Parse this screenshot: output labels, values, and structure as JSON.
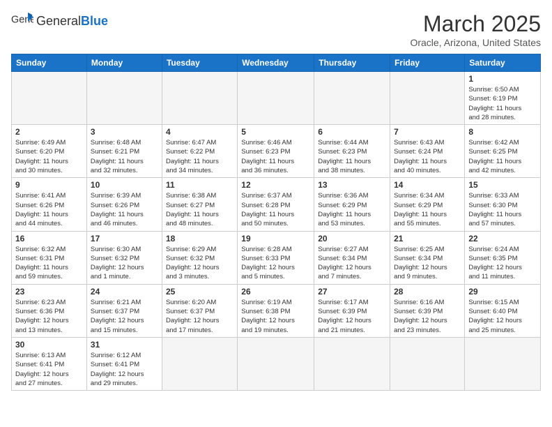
{
  "header": {
    "logo_general": "General",
    "logo_blue": "Blue",
    "month_title": "March 2025",
    "location": "Oracle, Arizona, United States"
  },
  "weekdays": [
    "Sunday",
    "Monday",
    "Tuesday",
    "Wednesday",
    "Thursday",
    "Friday",
    "Saturday"
  ],
  "weeks": [
    [
      {
        "day": "",
        "info": ""
      },
      {
        "day": "",
        "info": ""
      },
      {
        "day": "",
        "info": ""
      },
      {
        "day": "",
        "info": ""
      },
      {
        "day": "",
        "info": ""
      },
      {
        "day": "",
        "info": ""
      },
      {
        "day": "1",
        "info": "Sunrise: 6:50 AM\nSunset: 6:19 PM\nDaylight: 11 hours\nand 28 minutes."
      }
    ],
    [
      {
        "day": "2",
        "info": "Sunrise: 6:49 AM\nSunset: 6:20 PM\nDaylight: 11 hours\nand 30 minutes."
      },
      {
        "day": "3",
        "info": "Sunrise: 6:48 AM\nSunset: 6:21 PM\nDaylight: 11 hours\nand 32 minutes."
      },
      {
        "day": "4",
        "info": "Sunrise: 6:47 AM\nSunset: 6:22 PM\nDaylight: 11 hours\nand 34 minutes."
      },
      {
        "day": "5",
        "info": "Sunrise: 6:46 AM\nSunset: 6:23 PM\nDaylight: 11 hours\nand 36 minutes."
      },
      {
        "day": "6",
        "info": "Sunrise: 6:44 AM\nSunset: 6:23 PM\nDaylight: 11 hours\nand 38 minutes."
      },
      {
        "day": "7",
        "info": "Sunrise: 6:43 AM\nSunset: 6:24 PM\nDaylight: 11 hours\nand 40 minutes."
      },
      {
        "day": "8",
        "info": "Sunrise: 6:42 AM\nSunset: 6:25 PM\nDaylight: 11 hours\nand 42 minutes."
      }
    ],
    [
      {
        "day": "9",
        "info": "Sunrise: 6:41 AM\nSunset: 6:26 PM\nDaylight: 11 hours\nand 44 minutes."
      },
      {
        "day": "10",
        "info": "Sunrise: 6:39 AM\nSunset: 6:26 PM\nDaylight: 11 hours\nand 46 minutes."
      },
      {
        "day": "11",
        "info": "Sunrise: 6:38 AM\nSunset: 6:27 PM\nDaylight: 11 hours\nand 48 minutes."
      },
      {
        "day": "12",
        "info": "Sunrise: 6:37 AM\nSunset: 6:28 PM\nDaylight: 11 hours\nand 50 minutes."
      },
      {
        "day": "13",
        "info": "Sunrise: 6:36 AM\nSunset: 6:29 PM\nDaylight: 11 hours\nand 53 minutes."
      },
      {
        "day": "14",
        "info": "Sunrise: 6:34 AM\nSunset: 6:29 PM\nDaylight: 11 hours\nand 55 minutes."
      },
      {
        "day": "15",
        "info": "Sunrise: 6:33 AM\nSunset: 6:30 PM\nDaylight: 11 hours\nand 57 minutes."
      }
    ],
    [
      {
        "day": "16",
        "info": "Sunrise: 6:32 AM\nSunset: 6:31 PM\nDaylight: 11 hours\nand 59 minutes."
      },
      {
        "day": "17",
        "info": "Sunrise: 6:30 AM\nSunset: 6:32 PM\nDaylight: 12 hours\nand 1 minute."
      },
      {
        "day": "18",
        "info": "Sunrise: 6:29 AM\nSunset: 6:32 PM\nDaylight: 12 hours\nand 3 minutes."
      },
      {
        "day": "19",
        "info": "Sunrise: 6:28 AM\nSunset: 6:33 PM\nDaylight: 12 hours\nand 5 minutes."
      },
      {
        "day": "20",
        "info": "Sunrise: 6:27 AM\nSunset: 6:34 PM\nDaylight: 12 hours\nand 7 minutes."
      },
      {
        "day": "21",
        "info": "Sunrise: 6:25 AM\nSunset: 6:34 PM\nDaylight: 12 hours\nand 9 minutes."
      },
      {
        "day": "22",
        "info": "Sunrise: 6:24 AM\nSunset: 6:35 PM\nDaylight: 12 hours\nand 11 minutes."
      }
    ],
    [
      {
        "day": "23",
        "info": "Sunrise: 6:23 AM\nSunset: 6:36 PM\nDaylight: 12 hours\nand 13 minutes."
      },
      {
        "day": "24",
        "info": "Sunrise: 6:21 AM\nSunset: 6:37 PM\nDaylight: 12 hours\nand 15 minutes."
      },
      {
        "day": "25",
        "info": "Sunrise: 6:20 AM\nSunset: 6:37 PM\nDaylight: 12 hours\nand 17 minutes."
      },
      {
        "day": "26",
        "info": "Sunrise: 6:19 AM\nSunset: 6:38 PM\nDaylight: 12 hours\nand 19 minutes."
      },
      {
        "day": "27",
        "info": "Sunrise: 6:17 AM\nSunset: 6:39 PM\nDaylight: 12 hours\nand 21 minutes."
      },
      {
        "day": "28",
        "info": "Sunrise: 6:16 AM\nSunset: 6:39 PM\nDaylight: 12 hours\nand 23 minutes."
      },
      {
        "day": "29",
        "info": "Sunrise: 6:15 AM\nSunset: 6:40 PM\nDaylight: 12 hours\nand 25 minutes."
      }
    ],
    [
      {
        "day": "30",
        "info": "Sunrise: 6:13 AM\nSunset: 6:41 PM\nDaylight: 12 hours\nand 27 minutes."
      },
      {
        "day": "31",
        "info": "Sunrise: 6:12 AM\nSunset: 6:41 PM\nDaylight: 12 hours\nand 29 minutes."
      },
      {
        "day": "",
        "info": ""
      },
      {
        "day": "",
        "info": ""
      },
      {
        "day": "",
        "info": ""
      },
      {
        "day": "",
        "info": ""
      },
      {
        "day": "",
        "info": ""
      }
    ]
  ]
}
